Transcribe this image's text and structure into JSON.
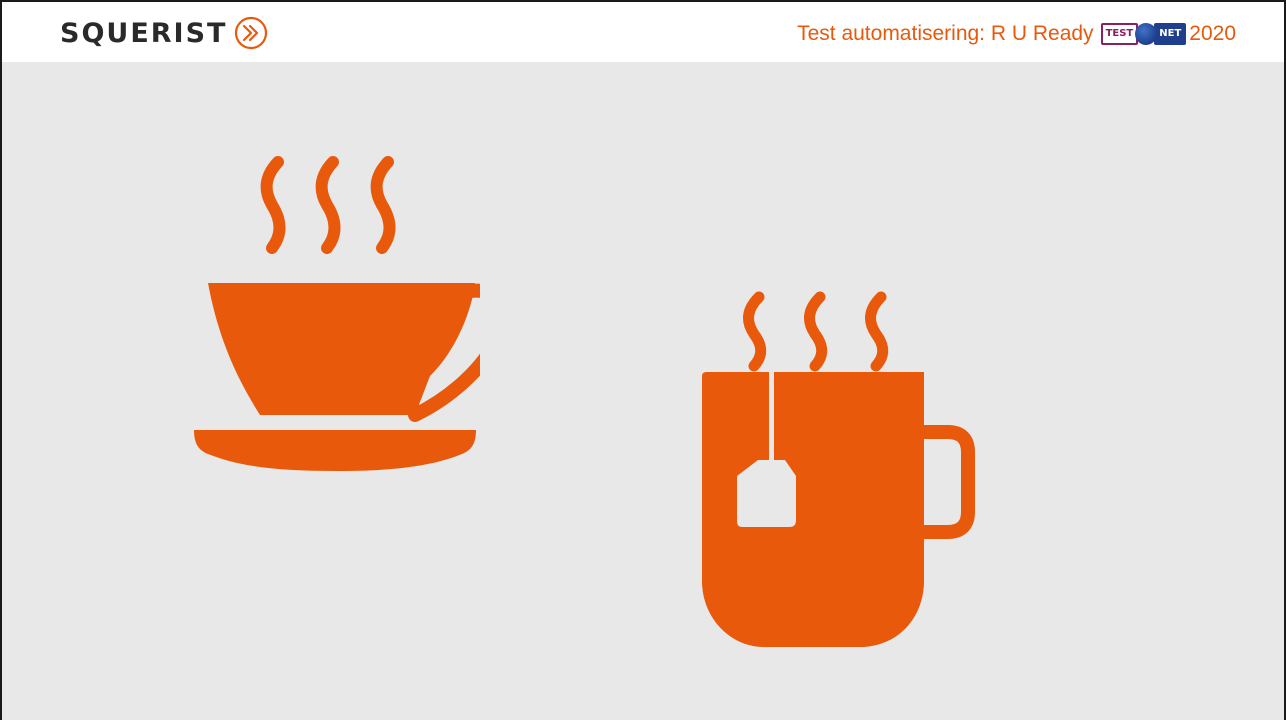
{
  "header": {
    "logo_text": "SQUERIST",
    "title_prefix": "Test automatisering: R U Ready",
    "testnet_test": "TEST",
    "testnet_net": "NET",
    "title_year": "2020"
  },
  "icons": {
    "teacup": "coffee-cup-icon",
    "mug": "tea-mug-icon"
  },
  "colors": {
    "accent": "#E8590C",
    "background": "#E7E8E7",
    "logo_text": "#2A2A2A",
    "testnet_purple": "#8B1F5F",
    "testnet_blue": "#1F3E8C"
  }
}
